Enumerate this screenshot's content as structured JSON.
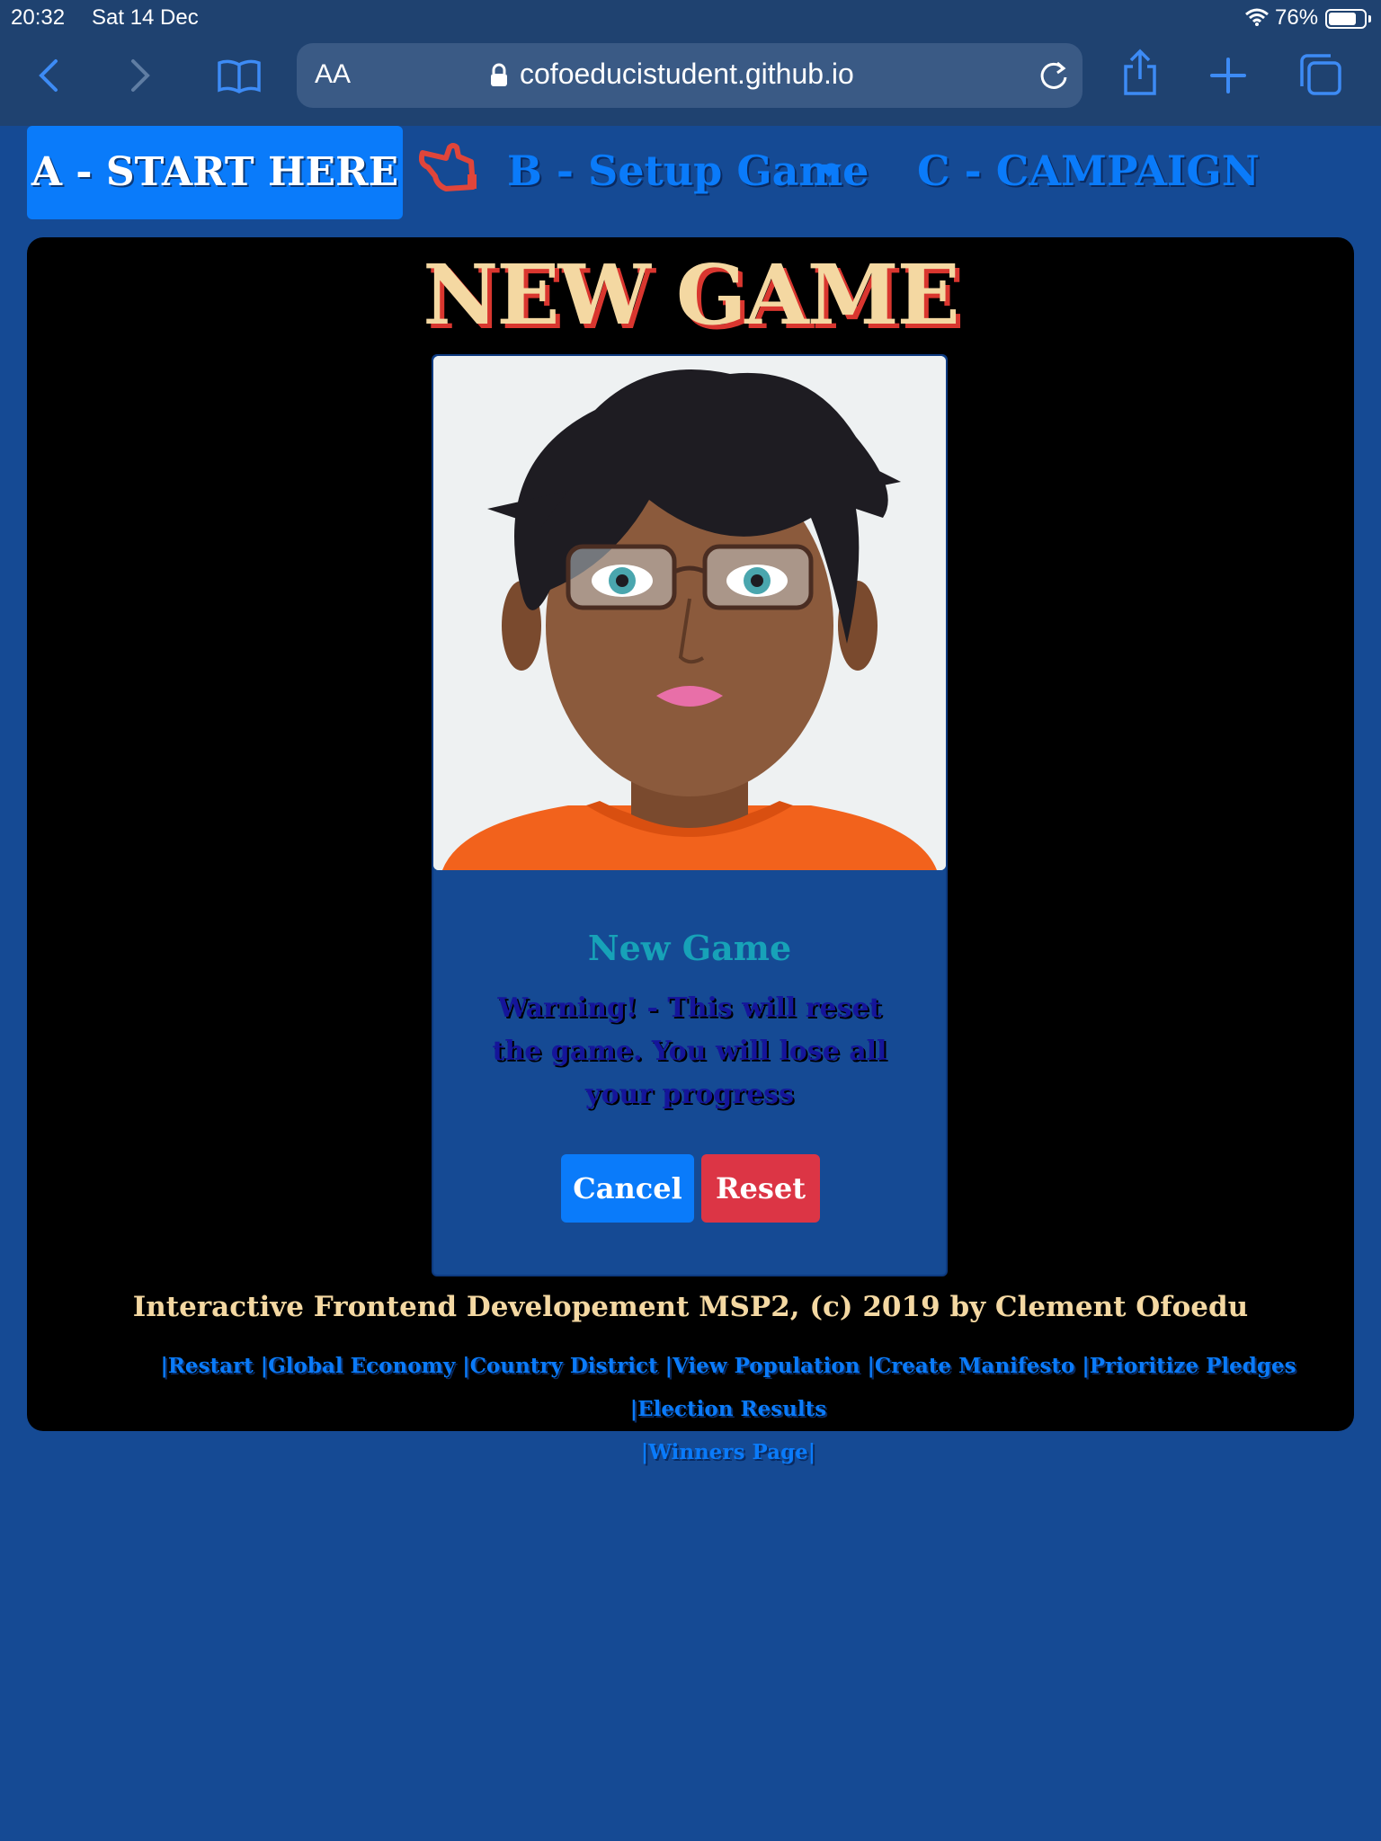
{
  "status_bar": {
    "time": "20:32",
    "date": "Sat 14 Dec",
    "battery": "76%"
  },
  "browser": {
    "aa": "AA",
    "url": "cofoeducistudent.github.io"
  },
  "nav": {
    "start": "A - START HERE",
    "setup": "B - Setup Game",
    "campaign": "C - CAMPAIGN"
  },
  "page": {
    "title": "NEW GAME",
    "card_title": "New Game",
    "warning": "Warning! - This will reset the game. You will lose all your progress",
    "cancel": "Cancel",
    "reset": "Reset"
  },
  "footer": {
    "credit": "Interactive Frontend Developement MSP2, (c) 2019 by Clement Ofoedu",
    "links": [
      "|Restart ",
      "|Global Economy ",
      "|Country District ",
      "|View Population ",
      "|Create Manifesto ",
      "|Prioritize Pledges ",
      "|Election Results ",
      "|Winners Page|"
    ]
  },
  "colors": {
    "page_bg": "#154a94",
    "accent_blue": "#0a7bfa",
    "danger": "#dc3545",
    "title_cream": "#f4d8a2",
    "title_shadow": "#d9362f",
    "card_title": "#17a2b8"
  },
  "icons": [
    "back-icon",
    "forward-icon",
    "bookmarks-icon",
    "lock-icon",
    "reload-icon",
    "share-icon",
    "new-tab-icon",
    "tabs-icon",
    "pointing-hand-icon",
    "caret-down-icon",
    "wifi-icon",
    "battery-icon"
  ]
}
